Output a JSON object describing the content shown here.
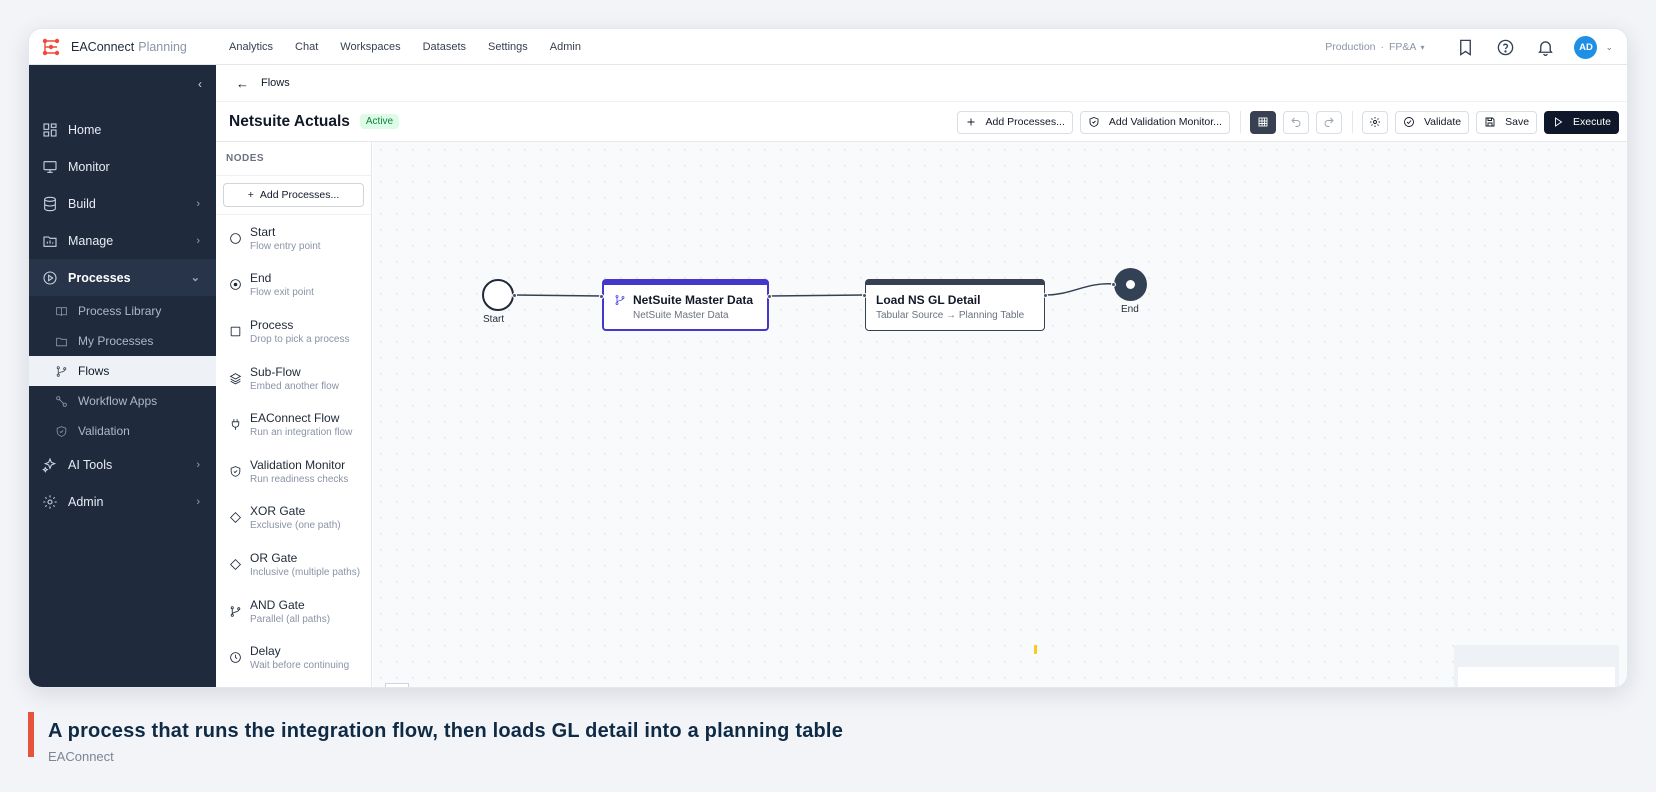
{
  "app": {
    "brand": "EAConnect",
    "brand_suffix": "Planning",
    "nav": [
      "Analytics",
      "Chat",
      "Workspaces",
      "Datasets",
      "Settings",
      "Admin"
    ],
    "env": "Production",
    "env_sep": "·",
    "workspace": "FP&A",
    "avatar_initials": "AD",
    "accent": "#1f8fe5"
  },
  "sidebar": {
    "items": [
      {
        "label": "Home",
        "icon": "home-icon"
      },
      {
        "label": "Monitor",
        "icon": "monitor-icon"
      },
      {
        "label": "Build",
        "icon": "database-icon"
      },
      {
        "label": "Manage",
        "icon": "folder-chart-icon"
      },
      {
        "label": "Processes",
        "icon": "play-circle-icon"
      },
      {
        "label": "AI Tools",
        "icon": "sparkles-icon"
      },
      {
        "label": "Admin",
        "icon": "gear-icon"
      }
    ],
    "sub_items": [
      {
        "label": "Process Library",
        "icon": "book-icon"
      },
      {
        "label": "My Processes",
        "icon": "folder-icon"
      },
      {
        "label": "Flows",
        "icon": "git-branch-icon"
      },
      {
        "label": "Workflow Apps",
        "icon": "workflow-icon"
      },
      {
        "label": "Validation",
        "icon": "shield-check-icon"
      }
    ]
  },
  "breadcrumb": {
    "back_label": "Flows"
  },
  "flow": {
    "title": "Netsuite Actuals",
    "status": "Active",
    "actions": {
      "add_processes": "Add Processes...",
      "add_validation": "Add Validation Monitor...",
      "validate": "Validate",
      "save": "Save",
      "execute": "Execute"
    }
  },
  "nodes_panel": {
    "header": "NODES",
    "add_button": "Add Processes...",
    "items": [
      {
        "title": "Start",
        "subtitle": "Flow entry point",
        "icon": "circle-icon"
      },
      {
        "title": "End",
        "subtitle": "Flow exit point",
        "icon": "circle-dot-icon"
      },
      {
        "title": "Process",
        "subtitle": "Drop to pick a process",
        "icon": "square-icon"
      },
      {
        "title": "Sub-Flow",
        "subtitle": "Embed another flow",
        "icon": "layers-icon"
      },
      {
        "title": "EAConnect Flow",
        "subtitle": "Run an integration flow",
        "icon": "plug-icon"
      },
      {
        "title": "Validation Monitor",
        "subtitle": "Run readiness checks",
        "icon": "shield-check-icon"
      },
      {
        "title": "XOR Gate",
        "subtitle": "Exclusive (one path)",
        "icon": "diamond-icon"
      },
      {
        "title": "OR Gate",
        "subtitle": "Inclusive (multiple paths)",
        "icon": "diamond-icon"
      },
      {
        "title": "AND Gate",
        "subtitle": "Parallel (all paths)",
        "icon": "git-branch-icon"
      },
      {
        "title": "Delay",
        "subtitle": "Wait before continuing",
        "icon": "clock-icon"
      }
    ]
  },
  "canvas": {
    "start_label": "Start",
    "end_label": "End",
    "node1": {
      "title": "NetSuite Master Data",
      "subtitle": "NetSuite Master Data",
      "color": "#4338ca"
    },
    "node2": {
      "title": "Load NS GL Detail",
      "subtitle": "Tabular Source → Planning Table",
      "color": "#374151"
    }
  },
  "caption": {
    "title": "A process that runs the integration flow, then loads GL detail into a planning table",
    "subtitle": "EAConnect",
    "accent": "#e5533c"
  }
}
